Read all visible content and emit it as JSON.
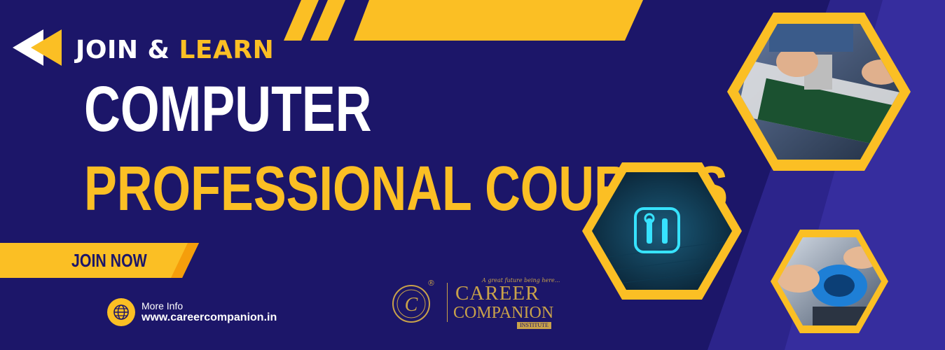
{
  "banner": {
    "tagline_part1": "JOIN & ",
    "tagline_part2": "LEARN",
    "headline_line1": "COMPUTER",
    "headline_line2": "PROFESSIONAL COURSES",
    "cta_label": "JOIN NOW",
    "more_info_label": "More Info",
    "website": "www.careercompanion.in"
  },
  "logo": {
    "tagline": "A great future being here...",
    "emblem_letter": "C",
    "registered_mark": "®",
    "word1": "CAREER",
    "word2": "COMPANION",
    "word3": "INSTITUTE"
  },
  "icons": {
    "arrows": "double-left-arrow-icon",
    "globe": "globe-icon",
    "tools": "screwdriver-wrench-icon"
  },
  "colors": {
    "background": "#1c1669",
    "accent_yellow": "#fbbf24",
    "logo_gold": "#c9a24a",
    "white": "#ffffff"
  }
}
